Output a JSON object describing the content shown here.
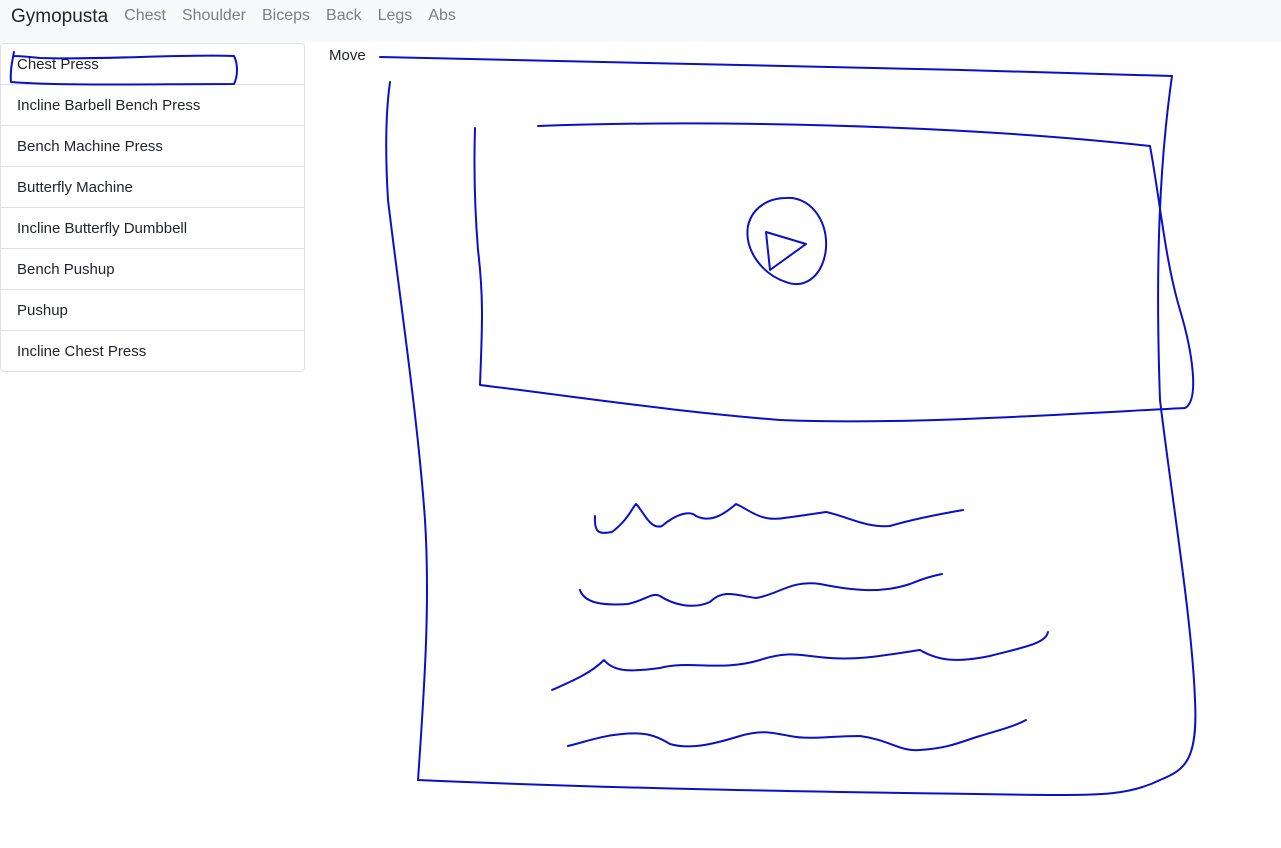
{
  "navbar": {
    "brand": "Gymopusta",
    "links": [
      "Chest",
      "Shoulder",
      "Biceps",
      "Back",
      "Legs",
      "Abs"
    ]
  },
  "sidebar": {
    "items": [
      "Chest Press",
      "Incline Barbell Bench Press",
      "Bench Machine Press",
      "Butterfly Machine",
      "Incline Butterfly Dumbbell",
      "Bench Pushup",
      "Pushup",
      "Incline Chest Press"
    ],
    "selected_index": 0
  },
  "content": {
    "label": "Move"
  },
  "colors": {
    "sketch_stroke": "#0a10c8",
    "navbar_bg": "#f8f9fa",
    "nav_link": "#7b7f84"
  },
  "icons": [
    "play-icon"
  ]
}
